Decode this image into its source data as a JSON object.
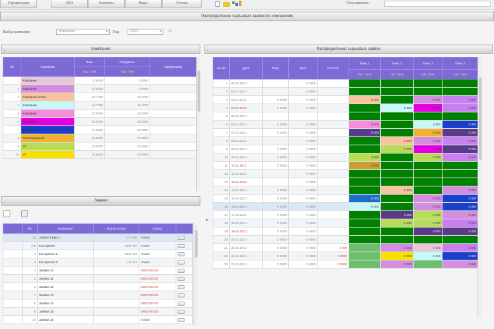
{
  "topbar": {
    "buttons": [
      "Справочники",
      "ОКО",
      "Контакты",
      "Виды",
      "Отчеты"
    ],
    "right_label": "Пользователь:",
    "colors": {
      "accent": "#7d6ad6",
      "header_text": "#ffe46a"
    }
  },
  "page_title": "Распределение сырьевых заявок по компаниям",
  "filter": {
    "company_label": "Выбор компании:",
    "company_value": "Компания",
    "year_label": "Год:",
    "year_value": "2013",
    "refresh_icon": "refresh-icon"
  },
  "left_panel": {
    "title": "Компании",
    "columns": [
      "№",
      "Компания",
      "План",
      "Отгружено",
      "Примечание"
    ],
    "subcolumns": [
      "",
      "",
      "тыс. тонн",
      "тыс. тонн",
      ""
    ],
    "rows": [
      {
        "id": "1",
        "name": "Компания",
        "color": "#e8c9d9",
        "plan": "11 0000",
        "shipped": "0 0000"
      },
      {
        "id": "2",
        "name": "Компания",
        "color": "#d48ee0",
        "plan": "12 0000",
        "shipped": "0 0000"
      },
      {
        "id": "3",
        "name": "Компания 2013 г.",
        "color": "#f8c49e",
        "plan": "13 7735",
        "shipped": "13 7735"
      },
      {
        "id": "4",
        "name": "Компания",
        "color": "#c8f8f8",
        "plan": "14 7735",
        "shipped": "11 7735"
      },
      {
        "id": "5",
        "name": "Компания",
        "color": "#f88cdc",
        "plan": "15 0000",
        "shipped": "14 0000"
      },
      {
        "id": "6",
        "name": "Компания",
        "color": "#e000e0",
        "plan": "16 0000",
        "shipped": "15 0000"
      },
      {
        "id": "7",
        "name": "Компания",
        "color": "#1a3fc8",
        "plan": "17 0000",
        "shipped": "16 0000"
      },
      {
        "id": "8",
        "name": "ОАО Компания",
        "color": "#f0b230",
        "plan": "18 0000",
        "shipped": "17 0000"
      },
      {
        "id": "9",
        "name": "ЗТ",
        "color": "#b8dc58",
        "plan": "19 0000",
        "shipped": "18 0000"
      },
      {
        "id": "10",
        "name": "ЗТ",
        "color": "#f8e000",
        "plan": "20 0000",
        "shipped": "19 0000"
      }
    ]
  },
  "requests_panel": {
    "title": "Заявки",
    "columns": [
      "",
      "№",
      "Контрагент",
      "Кол-во (тонн)",
      "Статус",
      ""
    ],
    "rows": [
      {
        "n": "18",
        "name": "ЗАКАЗ 1 (вал.)",
        "qty": "101 000",
        "status": "Новая",
        "status_class": ""
      },
      {
        "n": "119",
        "name": "Контрагент",
        "qty": "1000 000",
        "status": "Новая",
        "status_class": ""
      },
      {
        "n": "4",
        "name": "Контрагент 1",
        "qty": "2000 000",
        "status": "Новая",
        "status_class": ""
      },
      {
        "n": "4",
        "name": "Контрагент 2",
        "qty": "111 111",
        "status": "Новая",
        "status_class": ""
      },
      {
        "n": "4",
        "name": "Заявка 10",
        "qty": "",
        "status": "0000 000 00",
        "status_class": "red"
      },
      {
        "n": "5",
        "name": "Заявка 11",
        "qty": "",
        "status": "0000 000 00",
        "status_class": "red"
      },
      {
        "n": "6",
        "name": "Заявка 12",
        "qty": "",
        "status": "0000 000 00",
        "status_class": "red"
      },
      {
        "n": "7",
        "name": "Заявка 13",
        "qty": "",
        "status": "0000 000 00",
        "status_class": "red"
      },
      {
        "n": "8",
        "name": "Заявка 14",
        "qty": "",
        "status": "0000 000 00",
        "status_class": "red"
      },
      {
        "n": "9",
        "name": "Заявка 15",
        "qty": "",
        "status": "0000 000 00",
        "status_class": "red"
      },
      {
        "n": "10",
        "name": "Заявка 16",
        "qty": "",
        "status": "Новая",
        "status_class": ""
      }
    ]
  },
  "right_panel": {
    "title": "Распределение сырьевых заявок",
    "columns": [
      "№ п/п",
      "Дата",
      "План",
      "Факт",
      "Остаток",
      "Тонн. 1",
      "Тонн. 2",
      "Тонн. 3",
      "Тонн. 4"
    ],
    "subcolumns": [
      "",
      "",
      "",
      "",
      "",
      "тыс. тонн",
      "тыс. тонн",
      "тыс. тонн",
      "тыс. тонн"
    ],
    "rows": [
      {
        "n": "1",
        "date": "01.01.2013",
        "dred": false,
        "plan": "",
        "fact": "0 0000",
        "rest": "",
        "c": [
          "#008000",
          "#008000",
          "#008000",
          "#008000"
        ],
        "v": [
          "",
          "",
          "",
          ""
        ]
      },
      {
        "n": "2",
        "date": "02.01.2013",
        "dred": false,
        "plan": "",
        "fact": "0 0000",
        "rest": "",
        "c": [
          "#008000",
          "#008000",
          "#008000",
          "#008000"
        ],
        "v": [
          "",
          "",
          "",
          ""
        ]
      },
      {
        "n": "3",
        "date": "03.01.2013",
        "dred": false,
        "plan": "0 0000",
        "fact": "0 0000",
        "rest": "",
        "c": [
          "#f8c49e",
          "#008000",
          "#d48ee0",
          "#c880f0"
        ],
        "v": [
          "0 000",
          "",
          "0 000",
          "0 000"
        ]
      },
      {
        "n": "4",
        "date": "04.01.2013",
        "dred": true,
        "plan": "0 0000",
        "fact": "0 0000",
        "rest": "",
        "c": [
          "#008000",
          "#c8f8f8",
          "#e000e0",
          "#c880f0"
        ],
        "v": [
          "",
          "0 000",
          "0 000",
          "0 000"
        ]
      },
      {
        "n": "5",
        "date": "05.01.2013",
        "dred": false,
        "plan": "",
        "fact": "",
        "rest": "",
        "c": [
          "#008000",
          "#008000",
          "#008000",
          "#008000"
        ],
        "v": [
          "",
          "",
          "",
          ""
        ]
      },
      {
        "n": "6",
        "date": "06.01.2013",
        "dred": false,
        "plan": "0 0000",
        "fact": "0 0000",
        "rest": "",
        "c": [
          "#f88cdc",
          "#008000",
          "#c8f8f8",
          "#1a3fc8"
        ],
        "v": [
          "0 000",
          "",
          "0 000",
          "0 000"
        ]
      },
      {
        "n": "7",
        "date": "07.01.2013",
        "dred": false,
        "plan": "0 0000",
        "fact": "0 0000",
        "rest": "",
        "c": [
          "#5a3a8a",
          "#008000",
          "#f0b230",
          "#5a3a8a"
        ],
        "v": [
          "0 000",
          "",
          "0 000",
          "0 000"
        ]
      },
      {
        "n": "8",
        "date": "08.01.2013",
        "dred": false,
        "plan": "",
        "fact": "0 0000",
        "rest": "",
        "c": [
          "#008000",
          "#f8c49e",
          "#d48ee0",
          "#c880f0"
        ],
        "v": [
          "",
          "0 000",
          "0 000",
          "0 000"
        ]
      },
      {
        "n": "9",
        "date": "09.01.2013",
        "dred": false,
        "plan": "0 0000",
        "fact": "0 0000",
        "rest": "",
        "c": [
          "#008000",
          "#b8dc58",
          "#e000e0",
          "#5a3a8a"
        ],
        "v": [
          "",
          "0 000",
          "0 000",
          "0 000"
        ]
      },
      {
        "n": "10",
        "date": "10.01.2013",
        "dred": false,
        "plan": "0 0000",
        "fact": "0 0000",
        "rest": "",
        "c": [
          "#b8dc58",
          "#008000",
          "#b8dc58",
          "#c880f0"
        ],
        "v": [
          "0 000",
          "",
          "0 000",
          "0 000"
        ]
      },
      {
        "n": "11",
        "date": "11.01.2013",
        "dred": true,
        "plan": "0 0000",
        "fact": "0 0000",
        "rest": "",
        "c": [
          "#c8a030",
          "#008000",
          "#008000",
          "#008000"
        ],
        "v": [
          "0 000",
          "",
          "",
          ""
        ]
      },
      {
        "n": "12",
        "date": "12.01.2013",
        "dred": false,
        "plan": "",
        "fact": "0 0000",
        "rest": "",
        "c": [
          "#008000",
          "#008000",
          "#008000",
          "#008000"
        ],
        "v": [
          "",
          "",
          "",
          ""
        ]
      },
      {
        "n": "13",
        "date": "13.01.2013",
        "dred": true,
        "plan": "",
        "fact": "0 0000",
        "rest": "",
        "c": [
          "#008000",
          "#008000",
          "#008000",
          "#008000"
        ],
        "v": [
          "",
          "",
          "",
          ""
        ]
      },
      {
        "n": "14",
        "date": "14.01.2013",
        "dred": false,
        "plan": "0 0000",
        "fact": "0 0000",
        "rest": "",
        "c": [
          "#008000",
          "#f8c49e",
          "#008000",
          "#d48ee0"
        ],
        "v": [
          "",
          "0 000",
          "",
          "0 000"
        ]
      },
      {
        "n": "15",
        "date": "15.01.2013",
        "dred": false,
        "plan": "0 0000",
        "fact": "0 0000",
        "rest": "",
        "c": [
          "#1a6fc8",
          "#008000",
          "#d48ee0",
          "#1a3fc8"
        ],
        "v": [
          "0 000",
          "",
          "0 000",
          "0 000"
        ]
      },
      {
        "n": "16",
        "date": "16.01.2013",
        "dred": false,
        "plan": "0 0000",
        "fact": "0 0000",
        "rest": "",
        "c": [
          "#c8f8f8",
          "#008000",
          "#d48ee0",
          "#1a3fc8"
        ],
        "v": [
          "0 000",
          "",
          "0 000",
          "0 000"
        ]
      },
      {
        "n": "17",
        "date": "17.01.2013",
        "dred": false,
        "plan": "0 0000",
        "fact": "0 0000",
        "rest": "",
        "c": [
          "#008000",
          "#5a3a8a",
          "#b8dc58",
          "#d48ee0"
        ],
        "v": [
          "",
          "0 000",
          "0 000",
          "0 000"
        ]
      },
      {
        "n": "18",
        "date": "18.01.2013",
        "dred": false,
        "plan": "0 0000",
        "fact": "0 0000",
        "rest": "",
        "c": [
          "#008000",
          "#b8dc58",
          "#b8dc58",
          "#c880f0"
        ],
        "v": [
          "",
          "0 000",
          "0 000",
          "0 000"
        ]
      },
      {
        "n": "19",
        "date": "19.01.2013",
        "dred": true,
        "plan": "0 0000",
        "fact": "0 0000",
        "rest": "",
        "c": [
          "#008000",
          "#008000",
          "#5a3a8a",
          "#5a3a8a"
        ],
        "v": [
          "",
          "",
          "0 000",
          "0 000"
        ]
      },
      {
        "n": "20",
        "date": "20.01.2013",
        "dred": false,
        "plan": "0 0000",
        "fact": "0 0000",
        "rest": "",
        "c": [
          "#008000",
          "#008000",
          "#008000",
          "#008000"
        ],
        "v": [
          "",
          "",
          "",
          ""
        ]
      },
      {
        "n": "21",
        "date": "21.01.2013",
        "dred": false,
        "plan": "0 0000",
        "fact": "0 0000",
        "rest": "0 000",
        "c": [
          "#6cbf6c",
          "#d48ee0",
          "#e8c9d9",
          "#c880f0"
        ],
        "v": [
          "",
          "0 000",
          "0 000",
          "0 000"
        ]
      },
      {
        "n": "22",
        "date": "22.01.2013",
        "dred": false,
        "plan": "0 0000",
        "fact": "0 0000",
        "rest": "0 0000",
        "c": [
          "#6cbf6c",
          "#f8e000",
          "#c8f8f8",
          "#1a3fc8"
        ],
        "v": [
          "",
          "0 000",
          "0 000",
          "0 000"
        ]
      },
      {
        "n": "23",
        "date": "23.01.2013",
        "dred": false,
        "plan": "0 0000",
        "fact": "0 0000",
        "rest": "0 0000",
        "c": [
          "#6cbf6c",
          "#d48ee0",
          "#6cbf6c",
          "#d48ee0"
        ],
        "v": [
          "",
          "0 000",
          "",
          "0 000"
        ]
      }
    ]
  }
}
